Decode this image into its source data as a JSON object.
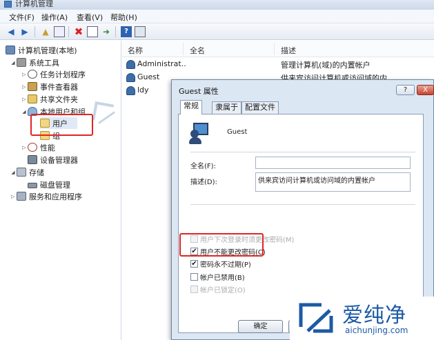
{
  "window": {
    "title": "计算机管理"
  },
  "menu": [
    "文件(F)",
    "操作(A)",
    "查看(V)",
    "帮助(H)"
  ],
  "toolbar": {
    "icons": [
      "back-arrow-icon",
      "forward-arrow-icon",
      "up-folder-icon",
      "show-hide-tree-icon",
      "delete-icon",
      "properties-icon",
      "export-icon",
      "help-icon",
      "view-icon"
    ]
  },
  "tree": {
    "root": "计算机管理(本地)",
    "system_tools": "系统工具",
    "task_scheduler": "任务计划程序",
    "event_viewer": "事件查看器",
    "shared_folders": "共享文件夹",
    "local_users_groups": "本地用户和组",
    "users": "用户",
    "groups": "组",
    "performance": "性能",
    "device_manager": "设备管理器",
    "storage": "存储",
    "disk_management": "磁盘管理",
    "services_apps": "服务和应用程序"
  },
  "list": {
    "columns": [
      "名称",
      "全名",
      "描述"
    ],
    "rows": [
      {
        "name": "Administrat...",
        "fullname": "",
        "desc": "管理计算机(域)的内置帐户"
      },
      {
        "name": "Guest",
        "fullname": "",
        "desc": "供来宾访问计算机或访问域的内"
      },
      {
        "name": "ldy",
        "fullname": "",
        "desc": ""
      }
    ]
  },
  "dialog": {
    "title": "Guest 属性",
    "help_btn": "?",
    "close_btn": "X",
    "tabs": [
      "常规",
      "隶属于",
      "配置文件"
    ],
    "username": "Guest",
    "fullname_label": "全名(F):",
    "fullname_value": "",
    "desc_label": "描述(D):",
    "desc_value": "供来宾访问计算机或访问域的内置帐户",
    "checks": [
      {
        "label": "用户下次登录时须更改密码(M)",
        "checked": false,
        "disabled": true
      },
      {
        "label": "用户不能更改密码(C)",
        "checked": true,
        "disabled": false
      },
      {
        "label": "密码永不过期(P)",
        "checked": true,
        "disabled": false
      },
      {
        "label": "帐户已禁用(B)",
        "checked": false,
        "disabled": false
      },
      {
        "label": "帐户已锁定(O)",
        "checked": false,
        "disabled": true
      }
    ],
    "ok": "确定"
  },
  "watermark": {
    "brand": "爱纯净",
    "site": "aichunjing.com",
    "left_text": "爱纯净"
  },
  "colors": {
    "highlight": "#e02424",
    "brand": "#1c5aa5"
  }
}
